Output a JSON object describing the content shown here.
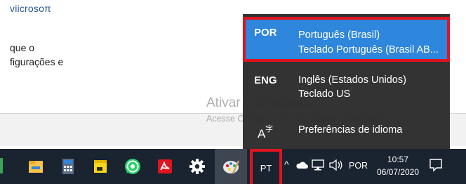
{
  "document": {
    "heading_fragment": "viicrosoπ",
    "line1": "que o",
    "line2": "figurações e"
  },
  "watermark": {
    "title": "Ativar o Windows",
    "subtitle": "Acesse Configurações para ativar o Windows."
  },
  "language_flyout": {
    "languages": [
      {
        "code": "POR",
        "name": "Português (Brasil)",
        "keyboard": "Teclado Português (Brasil AB..."
      },
      {
        "code": "ENG",
        "name": "Inglês (Estados Unidos)",
        "keyboard": "Teclado US"
      }
    ],
    "preferences_label": "Preferências de idioma",
    "selected_color": "#2f86dd",
    "highlight_color": "#e0141f"
  },
  "taskbar": {
    "pinned_apps": [
      {
        "name": "file-explorer-icon"
      },
      {
        "name": "calculator-icon"
      },
      {
        "name": "sticky-notes-icon"
      },
      {
        "name": "whatsapp-icon"
      },
      {
        "name": "acrobat-reader-icon"
      },
      {
        "name": "settings-icon"
      },
      {
        "name": "paint-icon"
      }
    ],
    "input_indicator": "PT",
    "tray_language": "POR",
    "clock_time": "10:57",
    "clock_date": "06/07/2020"
  }
}
